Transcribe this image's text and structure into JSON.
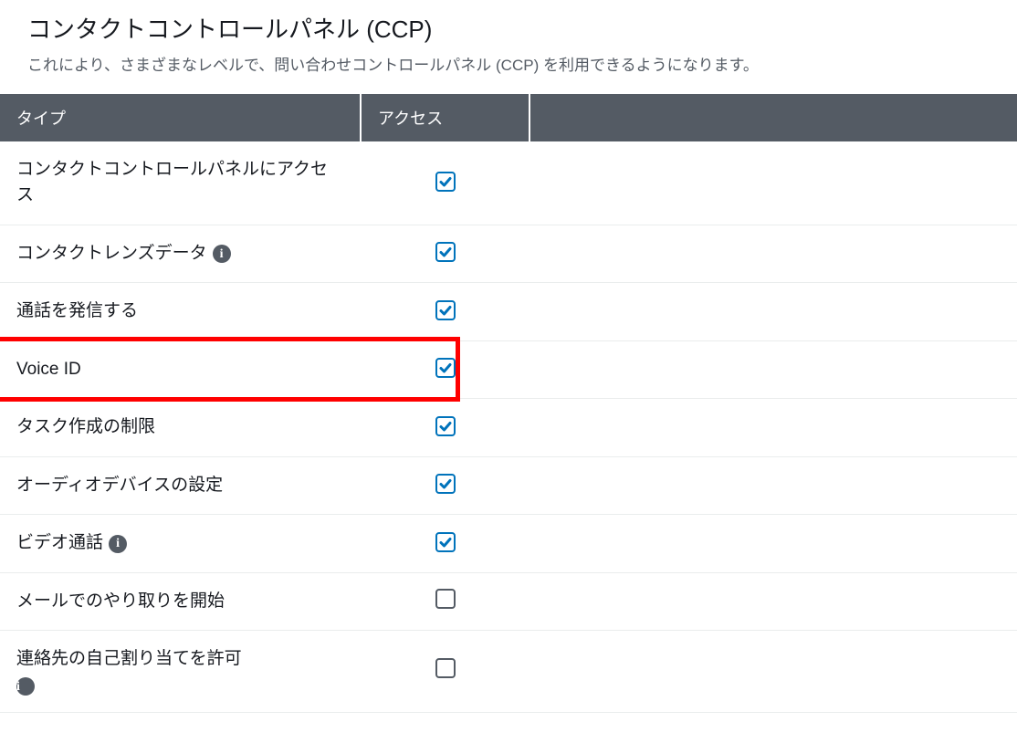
{
  "header": {
    "title": "コンタクトコントロールパネル (CCP)",
    "description": "これにより、さまざまなレベルで、問い合わせコントロールパネル (CCP) を利用できるようになります。"
  },
  "table": {
    "columns": {
      "type": "タイプ",
      "access": "アクセス"
    },
    "rows": [
      {
        "label": "コンタクトコントロールパネルにアクセス",
        "checked": true,
        "info": false,
        "highlight": false,
        "infoBelow": false
      },
      {
        "label": "コンタクトレンズデータ",
        "checked": true,
        "info": true,
        "highlight": false,
        "infoBelow": false
      },
      {
        "label": "通話を発信する",
        "checked": true,
        "info": false,
        "highlight": false,
        "infoBelow": false
      },
      {
        "label": "Voice ID",
        "checked": true,
        "info": false,
        "highlight": true,
        "infoBelow": false
      },
      {
        "label": "タスク作成の制限",
        "checked": true,
        "info": false,
        "highlight": false,
        "infoBelow": false
      },
      {
        "label": "オーディオデバイスの設定",
        "checked": true,
        "info": false,
        "highlight": false,
        "infoBelow": false
      },
      {
        "label": "ビデオ通話",
        "checked": true,
        "info": true,
        "highlight": false,
        "infoBelow": false
      },
      {
        "label": "メールでのやり取りを開始",
        "checked": false,
        "info": false,
        "highlight": false,
        "infoBelow": false
      },
      {
        "label": "連絡先の自己割り当てを許可",
        "checked": false,
        "info": true,
        "highlight": false,
        "infoBelow": true
      }
    ]
  },
  "icons": {
    "infoGlyph": "i"
  }
}
